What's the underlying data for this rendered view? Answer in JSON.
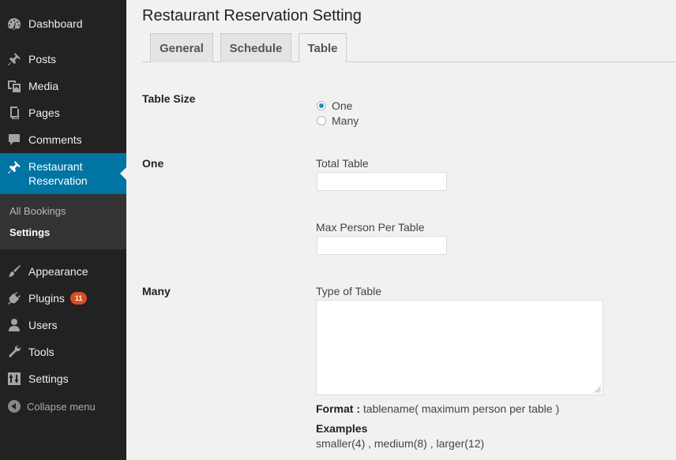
{
  "sidebar": {
    "items": [
      {
        "label": "Dashboard",
        "icon": "dashboard-icon"
      },
      {
        "label": "Posts",
        "icon": "pushpin-icon"
      },
      {
        "label": "Media",
        "icon": "media-icon"
      },
      {
        "label": "Pages",
        "icon": "pages-icon"
      },
      {
        "label": "Comments",
        "icon": "comment-icon"
      },
      {
        "label": "Restaurant Reservation",
        "icon": "pushpin-icon"
      },
      {
        "label": "Appearance",
        "icon": "paintbrush-icon"
      },
      {
        "label": "Plugins",
        "icon": "plugin-icon",
        "badge": "11"
      },
      {
        "label": "Users",
        "icon": "user-icon"
      },
      {
        "label": "Tools",
        "icon": "wrench-icon"
      },
      {
        "label": "Settings",
        "icon": "sliders-icon"
      }
    ],
    "submenu": [
      {
        "label": "All Bookings"
      },
      {
        "label": "Settings"
      }
    ],
    "collapse_label": "Collapse menu"
  },
  "main": {
    "title": "Restaurant Reservation Setting",
    "tabs": [
      {
        "label": "General"
      },
      {
        "label": "Schedule"
      },
      {
        "label": "Table"
      }
    ],
    "table_size": {
      "label": "Table Size",
      "options": [
        {
          "label": "One",
          "checked": true
        },
        {
          "label": "Many",
          "checked": false
        }
      ]
    },
    "one": {
      "label": "One",
      "total_table_label": "Total Table",
      "total_table_value": "",
      "max_person_label": "Max Person Per Table",
      "max_person_value": ""
    },
    "many": {
      "label": "Many",
      "type_label": "Type of Table",
      "type_value": "",
      "format_prefix": "Format :",
      "format_text": " tablename( maximum person per table )",
      "examples_title": "Examples",
      "examples_text": "smaller(4) , medium(8) , larger(12)"
    }
  },
  "colors": {
    "sidebar_bg": "#222222",
    "current_bg": "#0074a2",
    "badge_bg": "#d54e21",
    "content_bg": "#f1f1f1"
  }
}
